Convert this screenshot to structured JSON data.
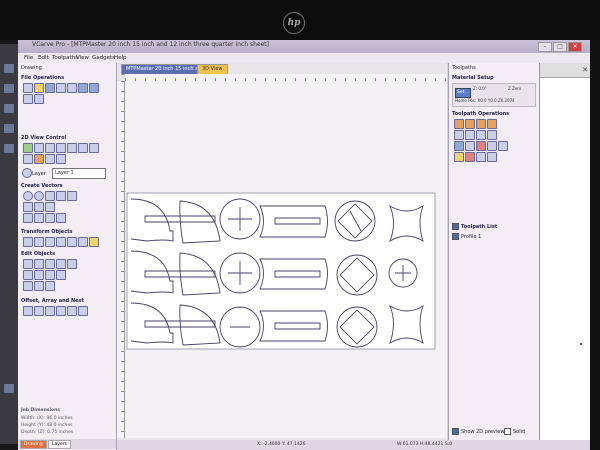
{
  "monitor": {
    "brand": "hp"
  },
  "window": {
    "title": "VCarve Pro - [MTPMaster 20 inch 15 inch and 12 inch three quarter inch sheet]",
    "buttons": [
      "–",
      "□",
      "✕"
    ]
  },
  "menu": [
    "File",
    "Edit",
    "Toolpaths",
    "View",
    "Gadgets",
    "Help"
  ],
  "left_panel": {
    "tab": "Drawing",
    "sections": {
      "file_ops": "File Operations",
      "view_control": "2D View Control",
      "create_vectors": "Create Vectors",
      "transform": "Transform Objects",
      "edit": "Edit Objects",
      "offset": "Offset, Array and Nest"
    },
    "layer_label": "Layer",
    "layer_value": "Layer 1",
    "dims_title": "Job Dimensions",
    "dims": [
      "Width: (X): 96.0 inches",
      "Height (Y): 48.0 inches",
      "Depth: (Z): 0.75 inches"
    ],
    "bottom_tabs": [
      "Drawing",
      "Layers"
    ]
  },
  "document": {
    "tab_active": "MTPMaster 20 inch 15 inch and 12...",
    "tab_other": "3D View"
  },
  "status": {
    "coords": "X: -2.4000 Y: 47.1426",
    "right": "W:61.073  H:48.4421  S:0"
  },
  "right_panel": {
    "title": "Toolpaths",
    "material_setup": "Material Setup",
    "set_btn": "Set...",
    "mat_z": "Z: 0.0\"",
    "mat_origin": "Z Zero",
    "home": "Home Pos:  X0.0 Y0.0 Z0.2074",
    "toolpath_ops": "Toolpath Operations",
    "toolpath_list": "Toolpath List",
    "profile": "Profile 1",
    "show_2d": "Show 2D previews",
    "solid": "Solid"
  },
  "colors": {
    "window_title_bg": "#bdb6cc",
    "panel_bg": "#f2eef4",
    "tab_active": "#5b6fb0",
    "tab_3d": "#f0c050",
    "drawing_tab_active": "#e07040",
    "vector_stroke": "#4a3f66"
  }
}
